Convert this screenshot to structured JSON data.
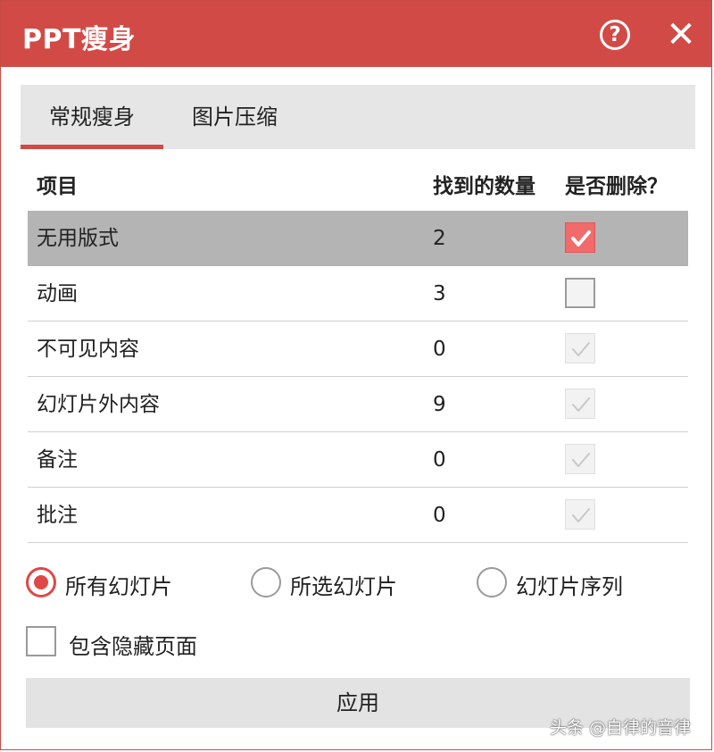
{
  "window": {
    "title": "PPT瘦身",
    "help": "?",
    "close": "✕"
  },
  "tabs": [
    {
      "label": "常规瘦身",
      "active": true
    },
    {
      "label": "图片压缩",
      "active": false
    }
  ],
  "table": {
    "headers": {
      "item": "项目",
      "count": "找到的数量",
      "delete": "是否删除？"
    },
    "rows": [
      {
        "name": "无用版式",
        "count": "2",
        "state": "checked"
      },
      {
        "name": "动画",
        "count": "3",
        "state": "unchecked"
      },
      {
        "name": "不可见内容",
        "count": "0",
        "state": "disabled"
      },
      {
        "name": "幻灯片外内容",
        "count": "9",
        "state": "disabled"
      },
      {
        "name": "备注",
        "count": "0",
        "state": "disabled"
      },
      {
        "name": "批注",
        "count": "0",
        "state": "disabled"
      }
    ]
  },
  "scope": {
    "options": [
      {
        "label": "所有幻灯片",
        "selected": true
      },
      {
        "label": "所选幻灯片",
        "selected": false
      },
      {
        "label": "幻灯片序列",
        "selected": false
      }
    ]
  },
  "include_hidden": {
    "label": "包含隐藏页面",
    "checked": false
  },
  "apply_label": "应用",
  "watermark": "头条 @自律的音律",
  "colors": {
    "accent": "#d24a46",
    "check_fill": "#f26b6b",
    "selected_row": "#b4b4b4"
  }
}
